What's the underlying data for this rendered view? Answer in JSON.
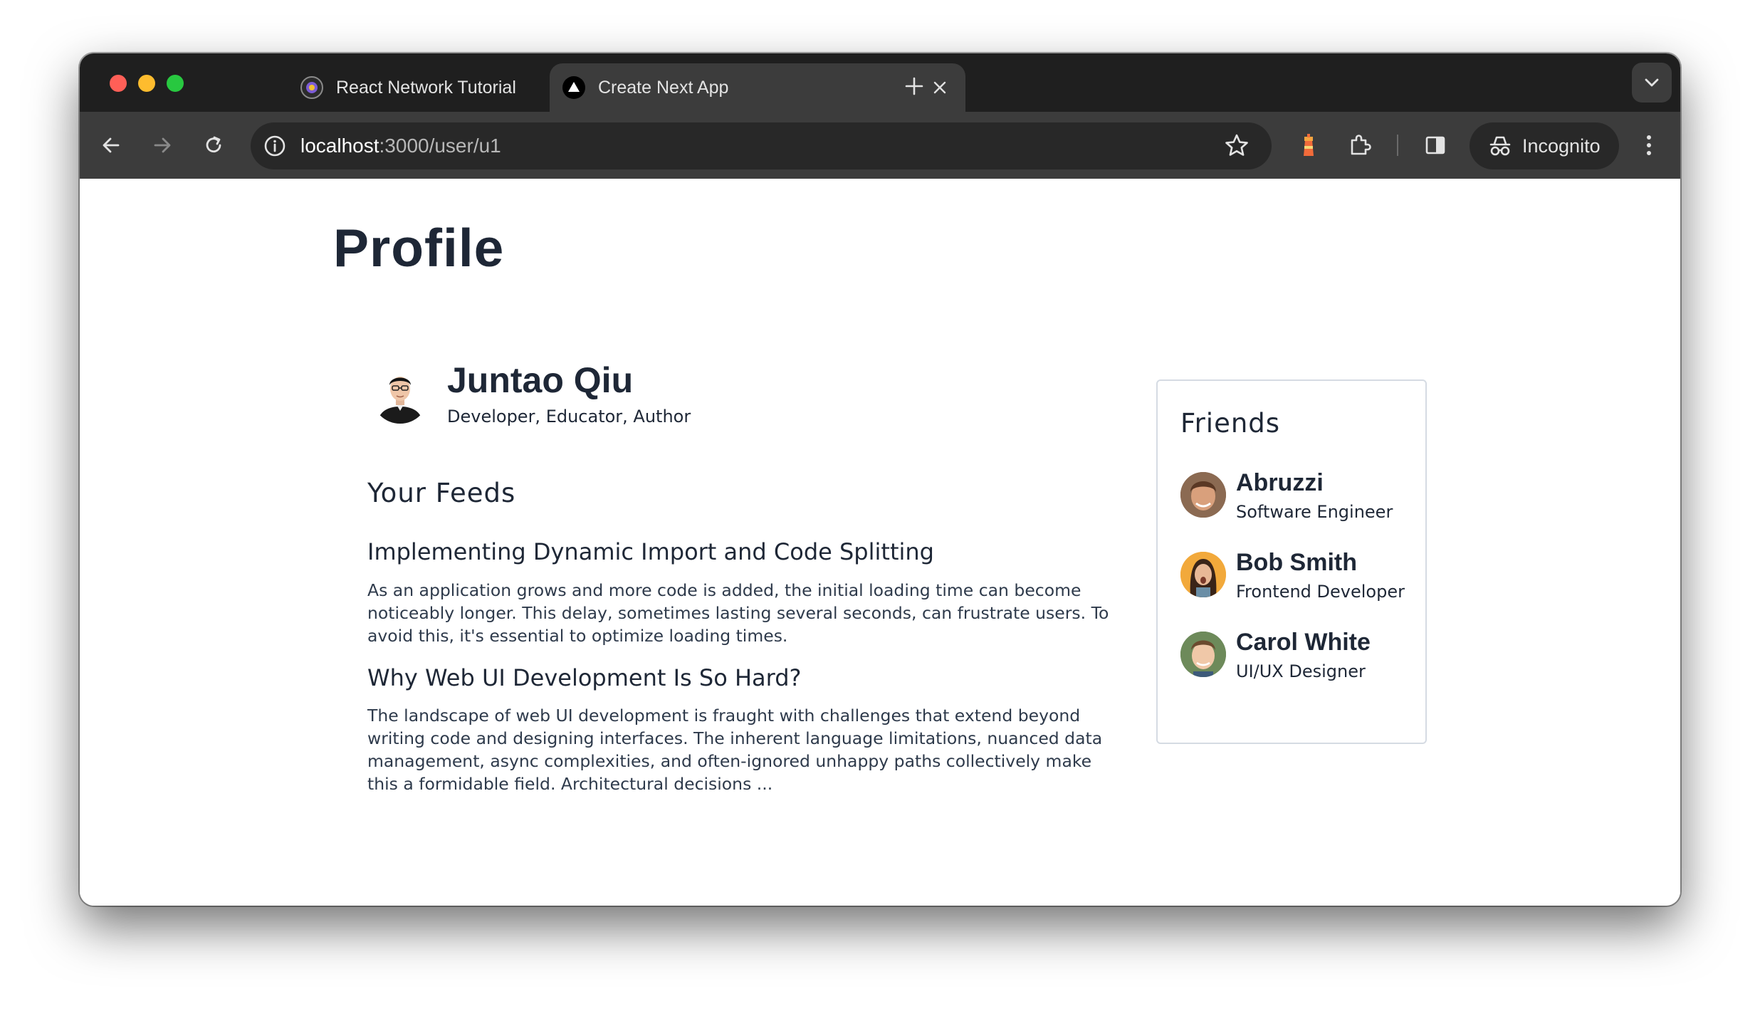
{
  "browser": {
    "tabs": [
      {
        "title": "React Network Tutorial",
        "active": false
      },
      {
        "title": "Create Next App",
        "active": true
      }
    ],
    "url_host": "localhost",
    "url_path": ":3000/user/u1",
    "incognito_label": "Incognito"
  },
  "page": {
    "title": "Profile",
    "user": {
      "name": "Juntao Qiu",
      "bio": "Developer, Educator, Author"
    },
    "feeds_heading": "Your Feeds",
    "feeds": [
      {
        "title": "Implementing Dynamic Import and Code Splitting",
        "body": "As an application grows and more code is added, the initial loading time can become noticeably longer. This delay, sometimes lasting several seconds, can frustrate users. To avoid this, it's essential to optimize loading times."
      },
      {
        "title": "Why Web UI Development Is So Hard?",
        "body": "The landscape of web UI development is fraught with challenges that extend beyond writing code and designing interfaces. The inherent language limitations, nuanced data management, async complexities, and often-ignored unhappy paths collectively make this a formidable field. Architectural decisions ..."
      }
    ],
    "friends_heading": "Friends",
    "friends": [
      {
        "name": "Abruzzi",
        "role": "Software Engineer"
      },
      {
        "name": "Bob Smith",
        "role": "Frontend Developer"
      },
      {
        "name": "Carol White",
        "role": "UI/UX Designer"
      }
    ]
  },
  "colors": {
    "text": "#1e2736",
    "tab_strip": "#1f1f1f",
    "toolbar": "#3c3c3c",
    "card_border": "#d5dbe3"
  }
}
